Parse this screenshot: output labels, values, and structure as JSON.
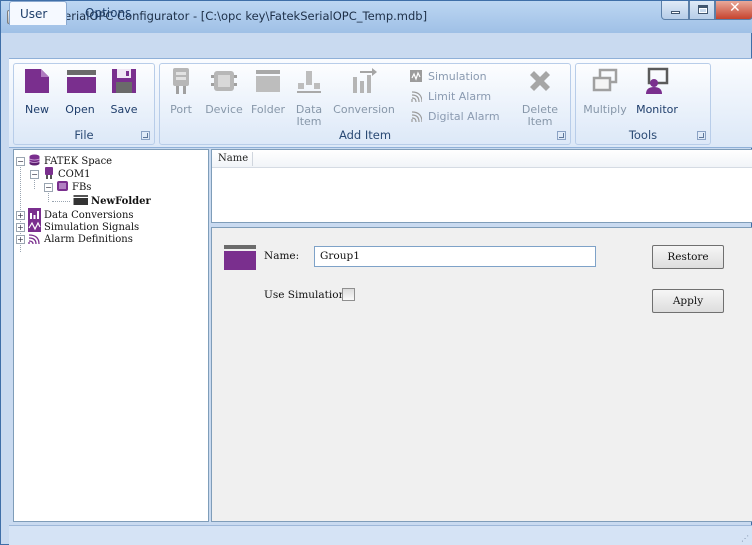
{
  "window": {
    "title": "FatekSerialOPC Configurator - [C:\\opc key\\FatekSerialOPC_Temp.mdb]",
    "app_icon": "OPC"
  },
  "ribbon_tabs": [
    {
      "label": "User",
      "selected": true
    },
    {
      "label": "Options",
      "selected": false
    }
  ],
  "ribbon": {
    "file_group": {
      "label": "File",
      "buttons": [
        {
          "label": "New",
          "icon": "new-file-icon",
          "enabled": true
        },
        {
          "label": "Open",
          "icon": "open-folder-icon",
          "enabled": true
        },
        {
          "label": "Save",
          "icon": "save-disk-icon",
          "enabled": true
        }
      ]
    },
    "add_item_group": {
      "label": "Add Item",
      "buttons": [
        {
          "label": "Port",
          "icon": "port-icon",
          "enabled": false
        },
        {
          "label": "Device",
          "icon": "device-icon",
          "enabled": false
        },
        {
          "label": "Folder",
          "icon": "folder-icon",
          "enabled": false
        },
        {
          "label": "Data Item",
          "icon": "data-item-icon",
          "enabled": false
        },
        {
          "label": "Conversion",
          "icon": "conversion-icon",
          "enabled": false
        }
      ],
      "small_items": [
        {
          "label": "Simulation",
          "icon": "simulation-icon"
        },
        {
          "label": "Limit  Alarm",
          "icon": "limit-alarm-icon"
        },
        {
          "label": "Digital Alarm",
          "icon": "digital-alarm-icon"
        }
      ],
      "delete_button": {
        "label": "Delete Item",
        "icon": "delete-x-icon",
        "enabled": false
      }
    },
    "tools_group": {
      "label": "Tools",
      "buttons": [
        {
          "label": "Multiply",
          "icon": "multiply-icon",
          "enabled": false
        },
        {
          "label": "Monitor",
          "icon": "monitor-icon",
          "enabled": true
        }
      ]
    }
  },
  "tree": {
    "root": "FATEK Space",
    "port": "COM1",
    "device": "FBs",
    "folder": "NewFolder",
    "data_conversions": "Data Conversions",
    "simulation_signals": "Simulation Signals",
    "alarm_definitions": "Alarm Definitions",
    "expand_collapsed": "+",
    "expand_open": "−"
  },
  "list": {
    "column_name": "Name"
  },
  "form": {
    "name_label": "Name:",
    "name_value": "Group1",
    "use_simulation_label": "Use Simulation:",
    "use_simulation_checked": false,
    "restore_label": "Restore",
    "apply_label": "Apply"
  },
  "colors": {
    "accent_purple": "#7a2f8e",
    "ribbon_text": "#1e3d6b",
    "disabled_text": "#8797a9"
  }
}
